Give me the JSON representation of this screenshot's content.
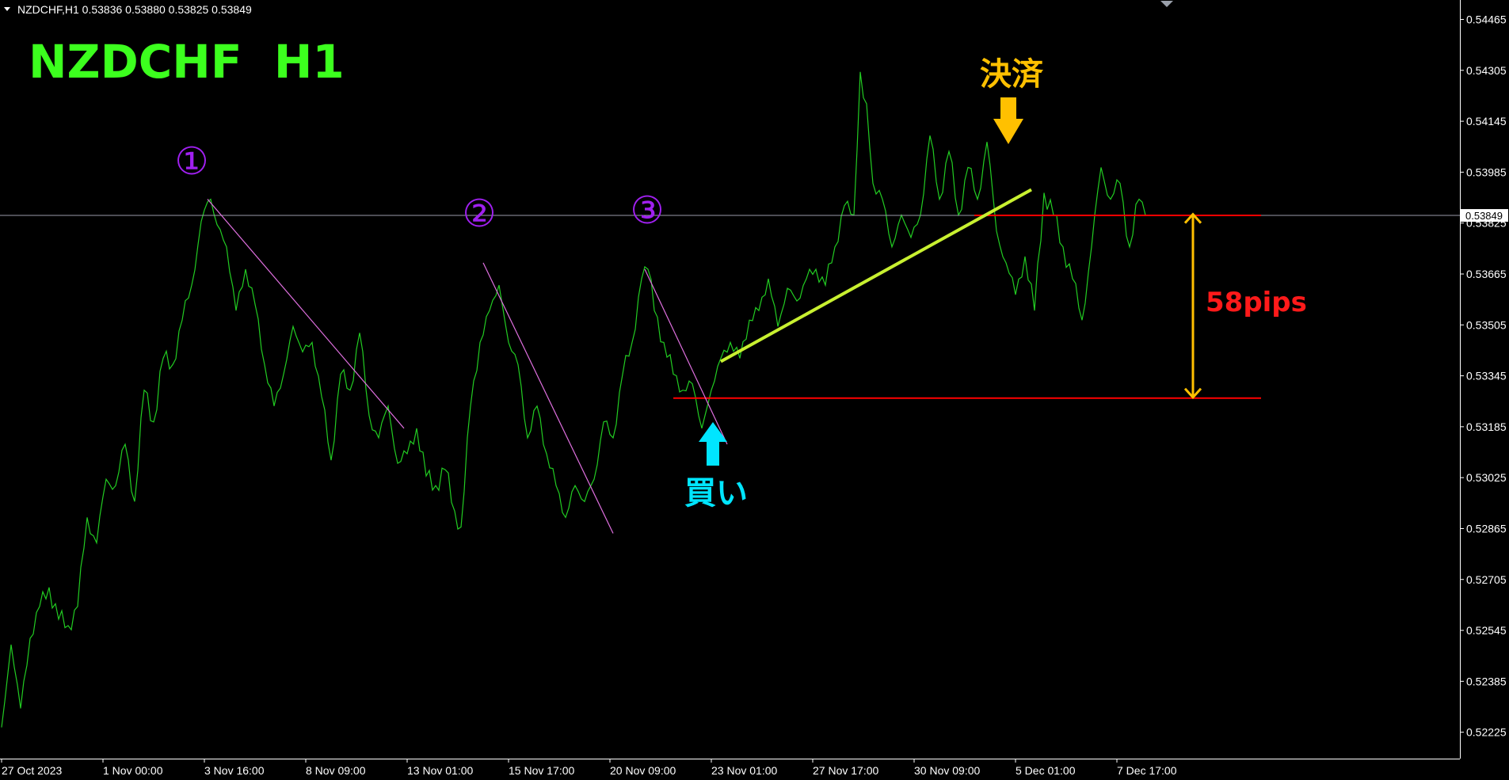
{
  "header": {
    "caption": "NZDCHF,H1  0.53836 0.53880 0.53825 0.53849"
  },
  "annotations": {
    "symbol_title": "NZDCHF  H1",
    "marker_1": "①",
    "marker_2": "②",
    "marker_3": "③",
    "buy_label": "買い",
    "exit_label": "決済",
    "pips_label": "58pips"
  },
  "colors": {
    "background": "#000000",
    "price_line": "#22cc22",
    "grid_frame": "#ffffff",
    "current_price_line": "#9a9aa8",
    "title_green": "#3cff1e",
    "marker_purple": "#a020f0",
    "buy_cyan": "#00e5ff",
    "exit_yellow": "#ffc000",
    "pips_red": "#ff1a1a",
    "trendline_magenta": "#e070e0",
    "support_line_yellowgreen": "#c8f030",
    "level_red": "#ff0000"
  },
  "chart_data": {
    "type": "line",
    "title": "NZDCHF,H1",
    "symbol": "NZDCHF",
    "timeframe": "H1",
    "ohlc_last": {
      "open": 0.53836,
      "high": 0.5388,
      "low": 0.53825,
      "close": 0.53849
    },
    "current_price": 0.53849,
    "current_price_label": "0.53849",
    "ylim": [
      0.52142,
      0.54526
    ],
    "y_ticks": [
      "0.54465",
      "0.54305",
      "0.54145",
      "0.53985",
      "0.53825",
      "0.53665",
      "0.53505",
      "0.53345",
      "0.53185",
      "0.53025",
      "0.52865",
      "0.52705",
      "0.52545",
      "0.52385",
      "0.52225"
    ],
    "y_tick_values": [
      0.54465,
      0.54305,
      0.54145,
      0.53985,
      0.53825,
      0.53665,
      0.53505,
      0.53345,
      0.53185,
      0.53025,
      0.52865,
      0.52705,
      0.52545,
      0.52385,
      0.52225
    ],
    "x_ticks": [
      "27 Oct 2023",
      "1 Nov 00:00",
      "3 Nov 16:00",
      "8 Nov 09:00",
      "13 Nov 01:00",
      "15 Nov 17:00",
      "20 Nov 09:00",
      "23 Nov 01:00",
      "27 Nov 17:00",
      "30 Nov 09:00",
      "5 Dec 01:00",
      "7 Dec 17:00"
    ],
    "x_tick_bar_index": [
      0,
      32,
      64,
      96,
      128,
      160,
      192,
      224,
      256,
      288,
      320,
      352
    ],
    "bars_visible_total": 460,
    "series": [
      {
        "name": "NZDCHF,H1",
        "points": [
          [
            0,
            0.5224
          ],
          [
            3,
            0.525
          ],
          [
            6,
            0.523
          ],
          [
            9,
            0.5252
          ],
          [
            12,
            0.5262
          ],
          [
            15,
            0.5268
          ],
          [
            18,
            0.5258
          ],
          [
            21,
            0.5256
          ],
          [
            24,
            0.5262
          ],
          [
            27,
            0.529
          ],
          [
            30,
            0.5282
          ],
          [
            33,
            0.5302
          ],
          [
            36,
            0.53
          ],
          [
            39,
            0.5313
          ],
          [
            42,
            0.5295
          ],
          [
            45,
            0.533
          ],
          [
            48,
            0.532
          ],
          [
            51,
            0.534
          ],
          [
            54,
            0.5338
          ],
          [
            57,
            0.5352
          ],
          [
            60,
            0.5363
          ],
          [
            63,
            0.5383
          ],
          [
            66,
            0.539
          ],
          [
            68,
            0.5382
          ],
          [
            71,
            0.5375
          ],
          [
            74,
            0.5355
          ],
          [
            77,
            0.5368
          ],
          [
            80,
            0.5357
          ],
          [
            83,
            0.5338
          ],
          [
            86,
            0.5325
          ],
          [
            89,
            0.5335
          ],
          [
            92,
            0.535
          ],
          [
            95,
            0.5342
          ],
          [
            98,
            0.5345
          ],
          [
            101,
            0.5328
          ],
          [
            104,
            0.5308
          ],
          [
            107,
            0.5335
          ],
          [
            110,
            0.533
          ],
          [
            113,
            0.5348
          ],
          [
            116,
            0.5322
          ],
          [
            119,
            0.5315
          ],
          [
            122,
            0.5325
          ],
          [
            125,
            0.5307
          ],
          [
            128,
            0.531
          ],
          [
            131,
            0.5318
          ],
          [
            134,
            0.5303
          ],
          [
            137,
            0.53
          ],
          [
            140,
            0.5305
          ],
          [
            143,
            0.5292
          ],
          [
            145,
            0.5287
          ],
          [
            148,
            0.5325
          ],
          [
            151,
            0.5345
          ],
          [
            154,
            0.5355
          ],
          [
            157,
            0.5363
          ],
          [
            160,
            0.5345
          ],
          [
            163,
            0.5338
          ],
          [
            166,
            0.5315
          ],
          [
            169,
            0.5325
          ],
          [
            172,
            0.531
          ],
          [
            175,
            0.53
          ],
          [
            178,
            0.529
          ],
          [
            181,
            0.53
          ],
          [
            184,
            0.5295
          ],
          [
            187,
            0.5302
          ],
          [
            190,
            0.532
          ],
          [
            193,
            0.5315
          ],
          [
            196,
            0.5335
          ],
          [
            199,
            0.5345
          ],
          [
            202,
            0.5365
          ],
          [
            204,
            0.5368
          ],
          [
            206,
            0.5355
          ],
          [
            209,
            0.5345
          ],
          [
            212,
            0.5335
          ],
          [
            215,
            0.533
          ],
          [
            218,
            0.5332
          ],
          [
            221,
            0.5318
          ],
          [
            224,
            0.533
          ],
          [
            227,
            0.534
          ],
          [
            230,
            0.5345
          ],
          [
            233,
            0.534
          ],
          [
            236,
            0.5352
          ],
          [
            239,
            0.5355
          ],
          [
            242,
            0.5365
          ],
          [
            245,
            0.535
          ],
          [
            248,
            0.5362
          ],
          [
            251,
            0.5358
          ],
          [
            254,
            0.5365
          ],
          [
            257,
            0.5368
          ],
          [
            260,
            0.5363
          ],
          [
            263,
            0.5375
          ],
          [
            266,
            0.5388
          ],
          [
            269,
            0.5385
          ],
          [
            271,
            0.543
          ],
          [
            273,
            0.542
          ],
          [
            275,
            0.5395
          ],
          [
            278,
            0.539
          ],
          [
            281,
            0.5375
          ],
          [
            284,
            0.5385
          ],
          [
            287,
            0.5378
          ],
          [
            290,
            0.5385
          ],
          [
            293,
            0.541
          ],
          [
            296,
            0.539
          ],
          [
            299,
            0.5405
          ],
          [
            302,
            0.5385
          ],
          [
            305,
            0.54
          ],
          [
            308,
            0.539
          ],
          [
            311,
            0.5408
          ],
          [
            314,
            0.538
          ],
          [
            317,
            0.537
          ],
          [
            320,
            0.536
          ],
          [
            323,
            0.5372
          ],
          [
            326,
            0.5355
          ],
          [
            329,
            0.5392
          ],
          [
            332,
            0.5385
          ],
          [
            335,
            0.5375
          ],
          [
            338,
            0.5365
          ],
          [
            341,
            0.5352
          ],
          [
            344,
            0.5375
          ],
          [
            347,
            0.54
          ],
          [
            350,
            0.539
          ],
          [
            353,
            0.5395
          ],
          [
            356,
            0.5375
          ],
          [
            359,
            0.539
          ],
          [
            361,
            0.5385
          ]
        ]
      }
    ],
    "horizontal_levels": [
      0.53849,
      0.53275
    ],
    "pips_range": {
      "from": 0.53275,
      "to": 0.53855,
      "label": "58pips"
    },
    "trendlines": [
      {
        "color": "magenta",
        "from": [
          65,
          0.539
        ],
        "to": [
          127,
          0.5318
        ]
      },
      {
        "color": "magenta",
        "from": [
          152,
          0.537
        ],
        "to": [
          193,
          0.5285
        ]
      },
      {
        "color": "magenta",
        "from": [
          203,
          0.5368
        ],
        "to": [
          229,
          0.5313
        ]
      },
      {
        "color": "yellow-green",
        "from": [
          227,
          0.5339
        ],
        "to": [
          325,
          0.5393
        ]
      }
    ],
    "grid": false
  }
}
